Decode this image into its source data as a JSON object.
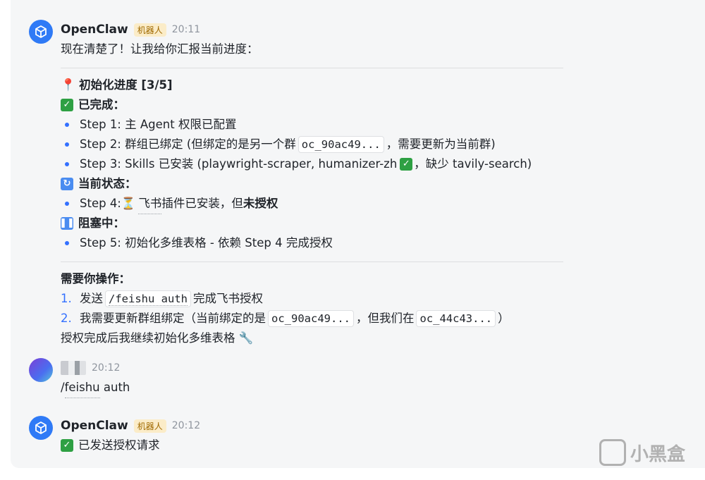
{
  "messages": [
    {
      "sender": "OpenClaw",
      "badge": "机器人",
      "time": "20:11",
      "intro": "现在清楚了！让我给你汇报当前进度：",
      "progress_title": "初始化进度 [3/5]",
      "done_heading": "已完成：",
      "done_items": {
        "s1": "Step 1: 主 Agent 权限已配置",
        "s2_pre": "Step 2: 群组已绑定 (但绑定的是另一个群",
        "s2_code": "oc_90ac49...",
        "s2_post": "，需要更新为当前群)",
        "s3_pre": "Step 3: Skills 已安装 (playwright-scraper, humanizer-zh",
        "s3_post": "，缺少 tavily-search)"
      },
      "current_heading": "当前状态：",
      "s4_pre": "Step 4: ",
      "s4_hourglass": "⏳",
      "s4_link": "飞书",
      "s4_mid": "插件已安装，但",
      "s4_bold": "未授权",
      "blocked_heading": "阻塞中：",
      "s5": "Step 5: 初始化多维表格 - 依赖 Step 4 完成授权",
      "action_heading": "需要你操作：",
      "action1_num": "1.",
      "action1_pre": "发送",
      "action1_code": "/feishu auth",
      "action1_post": "完成飞书授权",
      "action2_num": "2.",
      "action2_pre": "我需要更新群组绑定（当前绑定的是",
      "action2_code1": "oc_90ac49...",
      "action2_mid": "，但我们在",
      "action2_code2": "oc_44c43...",
      "action2_post": "）",
      "closing": "授权完成后我继续初始化多维表格 🔧"
    },
    {
      "sender": "",
      "time": "20:12",
      "text_pre": "/",
      "text_link": "feishu",
      "text_post": " auth"
    },
    {
      "sender": "OpenClaw",
      "badge": "机器人",
      "time": "20:12",
      "text": "已发送授权请求"
    }
  ],
  "watermark": "小黑盒",
  "colors": {
    "accent": "#3370ff",
    "check": "#2ea043",
    "badge_bg": "#fbecc8"
  },
  "icons": [
    "cube-avatar-icon",
    "pin-icon",
    "check-icon",
    "sync-icon",
    "pause-icon",
    "hourglass-icon",
    "wrench-icon"
  ]
}
